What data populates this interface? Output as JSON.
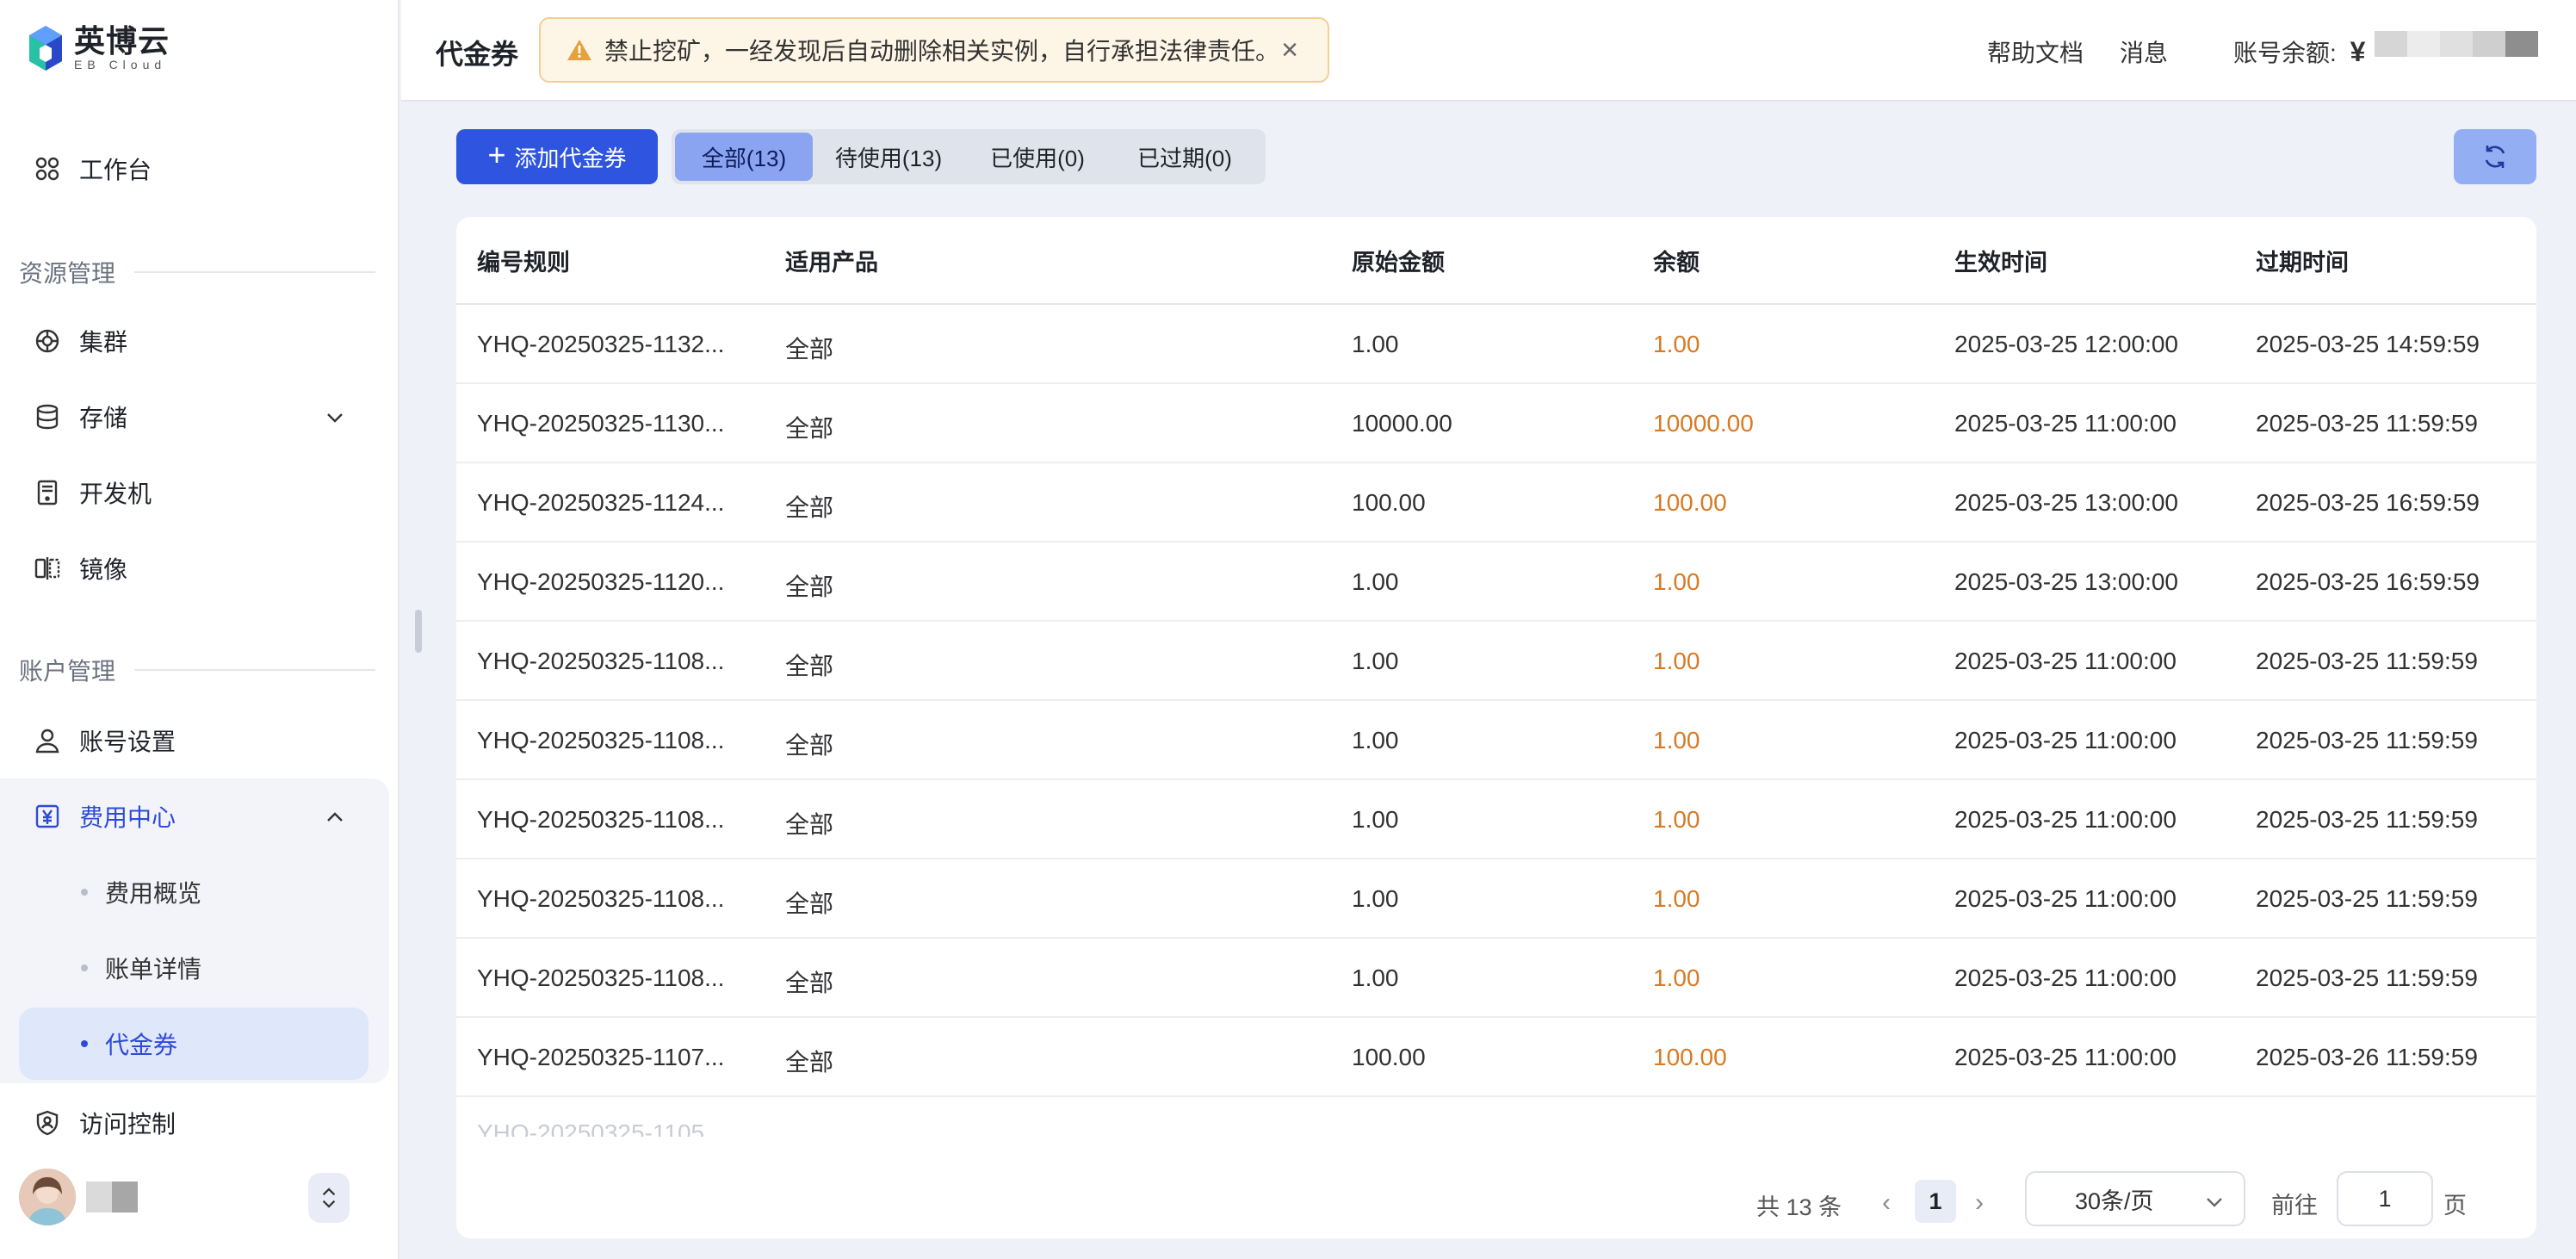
{
  "brand": {
    "name_cn": "英博云",
    "name_en": "EB Cloud"
  },
  "sidebar": {
    "workbench": "工作台",
    "sections": {
      "resources": "资源管理",
      "account": "账户管理"
    },
    "items": {
      "cluster": "集群",
      "storage": "存储",
      "devbox": "开发机",
      "image": "镜像",
      "account_settings": "账号设置",
      "billing_center": "费用中心",
      "access_control": "访问控制"
    },
    "billing_sub": {
      "overview": "费用概览",
      "bill_detail": "账单详情",
      "voucher": "代金券"
    }
  },
  "header": {
    "title": "代金券",
    "alert": "禁止挖矿，一经发现后自动删除相关实例，自行承担法律责任。",
    "help_docs": "帮助文档",
    "messages": "消息",
    "balance_label": "账号余额:",
    "currency": "¥"
  },
  "toolbar": {
    "add_label": "添加代金券",
    "tabs": [
      "全部(13)",
      "待使用(13)",
      "已使用(0)",
      "已过期(0)"
    ]
  },
  "table": {
    "columns": [
      "编号规则",
      "适用产品",
      "原始金额",
      "余额",
      "生效时间",
      "过期时间"
    ],
    "rows": [
      [
        "YHQ-20250325-1132...",
        "全部",
        "1.00",
        "1.00",
        "2025-03-25 12:00:00",
        "2025-03-25 14:59:59"
      ],
      [
        "YHQ-20250325-1130...",
        "全部",
        "10000.00",
        "10000.00",
        "2025-03-25 11:00:00",
        "2025-03-25 11:59:59"
      ],
      [
        "YHQ-20250325-1124...",
        "全部",
        "100.00",
        "100.00",
        "2025-03-25 13:00:00",
        "2025-03-25 16:59:59"
      ],
      [
        "YHQ-20250325-1120...",
        "全部",
        "1.00",
        "1.00",
        "2025-03-25 13:00:00",
        "2025-03-25 16:59:59"
      ],
      [
        "YHQ-20250325-1108...",
        "全部",
        "1.00",
        "1.00",
        "2025-03-25 11:00:00",
        "2025-03-25 11:59:59"
      ],
      [
        "YHQ-20250325-1108...",
        "全部",
        "1.00",
        "1.00",
        "2025-03-25 11:00:00",
        "2025-03-25 11:59:59"
      ],
      [
        "YHQ-20250325-1108...",
        "全部",
        "1.00",
        "1.00",
        "2025-03-25 11:00:00",
        "2025-03-25 11:59:59"
      ],
      [
        "YHQ-20250325-1108...",
        "全部",
        "1.00",
        "1.00",
        "2025-03-25 11:00:00",
        "2025-03-25 11:59:59"
      ],
      [
        "YHQ-20250325-1108...",
        "全部",
        "1.00",
        "1.00",
        "2025-03-25 11:00:00",
        "2025-03-25 11:59:59"
      ],
      [
        "YHQ-20250325-1107...",
        "全部",
        "100.00",
        "100.00",
        "2025-03-25 11:00:00",
        "2025-03-26 11:59:59"
      ]
    ]
  },
  "pagination": {
    "total": "共 13 条",
    "current_page": "1",
    "page_size": "30条/页",
    "goto_label": "前往",
    "goto_value": "1",
    "page_unit": "页"
  },
  "colors": {
    "primary": "#2f55e0",
    "balance_orange": "#d87a24",
    "active_tab": "#8aa4f2",
    "alert_bg": "#fdf5e6",
    "alert_icon": "#e6a23c"
  }
}
